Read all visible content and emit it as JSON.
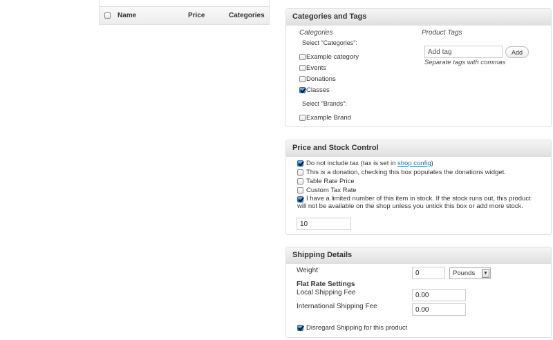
{
  "products_table": {
    "headers": [
      "Name",
      "Price",
      "Categories"
    ]
  },
  "categories_box": {
    "title": "Categories and Tags",
    "categories_heading": "Categories",
    "select_categories_label": "Select \"Categories\":",
    "categories": [
      {
        "label": "Example category",
        "checked": false
      },
      {
        "label": "Events",
        "checked": false
      },
      {
        "label": "Donations",
        "checked": false
      },
      {
        "label": "Classes",
        "checked": true
      }
    ],
    "select_brands_label": "Select \"Brands\":",
    "brands": [
      {
        "label": "Example Brand",
        "checked": false
      }
    ],
    "tags_heading": "Product Tags",
    "tag_input_placeholder": "Add tag",
    "add_button": "Add",
    "tags_hint": "Separate tags with commas"
  },
  "price_box": {
    "title": "Price and Stock Control",
    "no_tax_prefix": "Do not include tax (tax is set in ",
    "shop_config_link": "shop config",
    "no_tax_suffix": ")",
    "donation_label": "This is a donation, checking this box populates the donations widget.",
    "table_rate_label": "Table Rate Price",
    "custom_tax_label": "Custom Tax Rate",
    "stock_label": "I have a limited number of this item in stock. If the stock runs out, this product will not be available on the shop unless you untick this box or add more stock.",
    "stock_value": "10",
    "checked": {
      "no_tax": true,
      "donation": false,
      "table_rate": false,
      "custom_tax": false,
      "stock": true
    }
  },
  "shipping_box": {
    "title": "Shipping Details",
    "weight_label": "Weight",
    "weight_value": "0",
    "weight_unit": "Pounds",
    "flat_rate_heading": "Flat Rate Settings",
    "local_label": "Local Shipping Fee",
    "local_value": "0.00",
    "international_label": "International Shipping Fee",
    "international_value": "0.00",
    "disregard_label": "Disregard Shipping for this product",
    "disregard_checked": true
  }
}
